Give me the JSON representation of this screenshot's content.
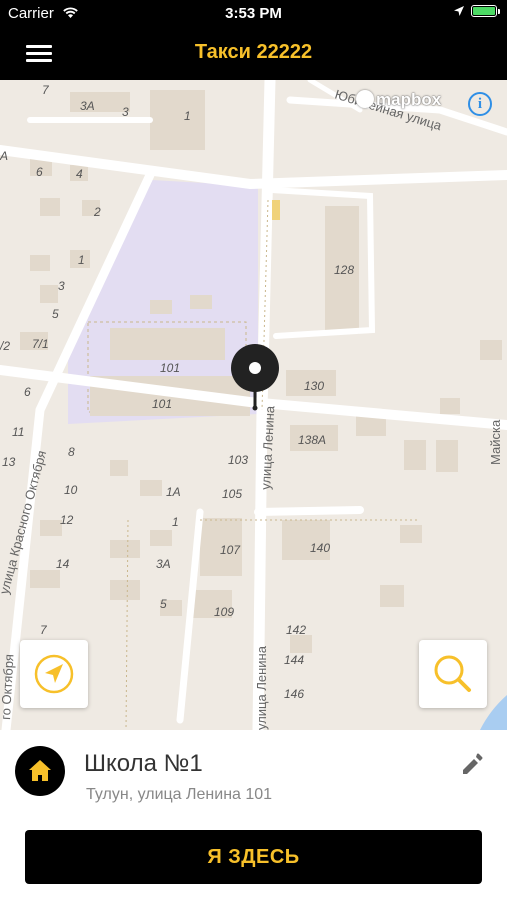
{
  "status_bar": {
    "carrier": "Carrier",
    "time": "3:53 PM",
    "battery_level": 1.0
  },
  "nav": {
    "title": "Такси 22222",
    "menu_icon": "hamburger-menu-icon"
  },
  "map": {
    "attribution": "mapbox",
    "info_label": "i",
    "streets": [
      "Юбилейная улица",
      "улица Ленина",
      "улица Ленина",
      "улица Красного Октября",
      "го Октября",
      "Майска"
    ],
    "house_numbers": [
      "7",
      "3А",
      "3",
      "1",
      "А",
      "6",
      "4",
      "2",
      "1",
      "3",
      "5",
      "7/1",
      "/2",
      "6",
      "11",
      "13",
      "8",
      "10",
      "12",
      "14",
      "7",
      "101",
      "101",
      "128",
      "130",
      "138А",
      "103",
      "1А",
      "105",
      "1",
      "107",
      "140",
      "3А",
      "5",
      "109",
      "142",
      "144",
      "146"
    ],
    "locate_button_icon": "navigation-arrow-icon",
    "search_button_icon": "search-icon"
  },
  "place": {
    "title": "Школа №1",
    "address": "Тулун, улица Ленина 101",
    "home_icon": "home-icon",
    "edit_icon": "pencil-icon"
  },
  "action": {
    "here_label": "Я ЗДЕСЬ"
  },
  "colors": {
    "accent": "#f7c02a",
    "bar": "#000000",
    "map_bg": "#efeae3",
    "school_area": "#e3ddf2"
  }
}
